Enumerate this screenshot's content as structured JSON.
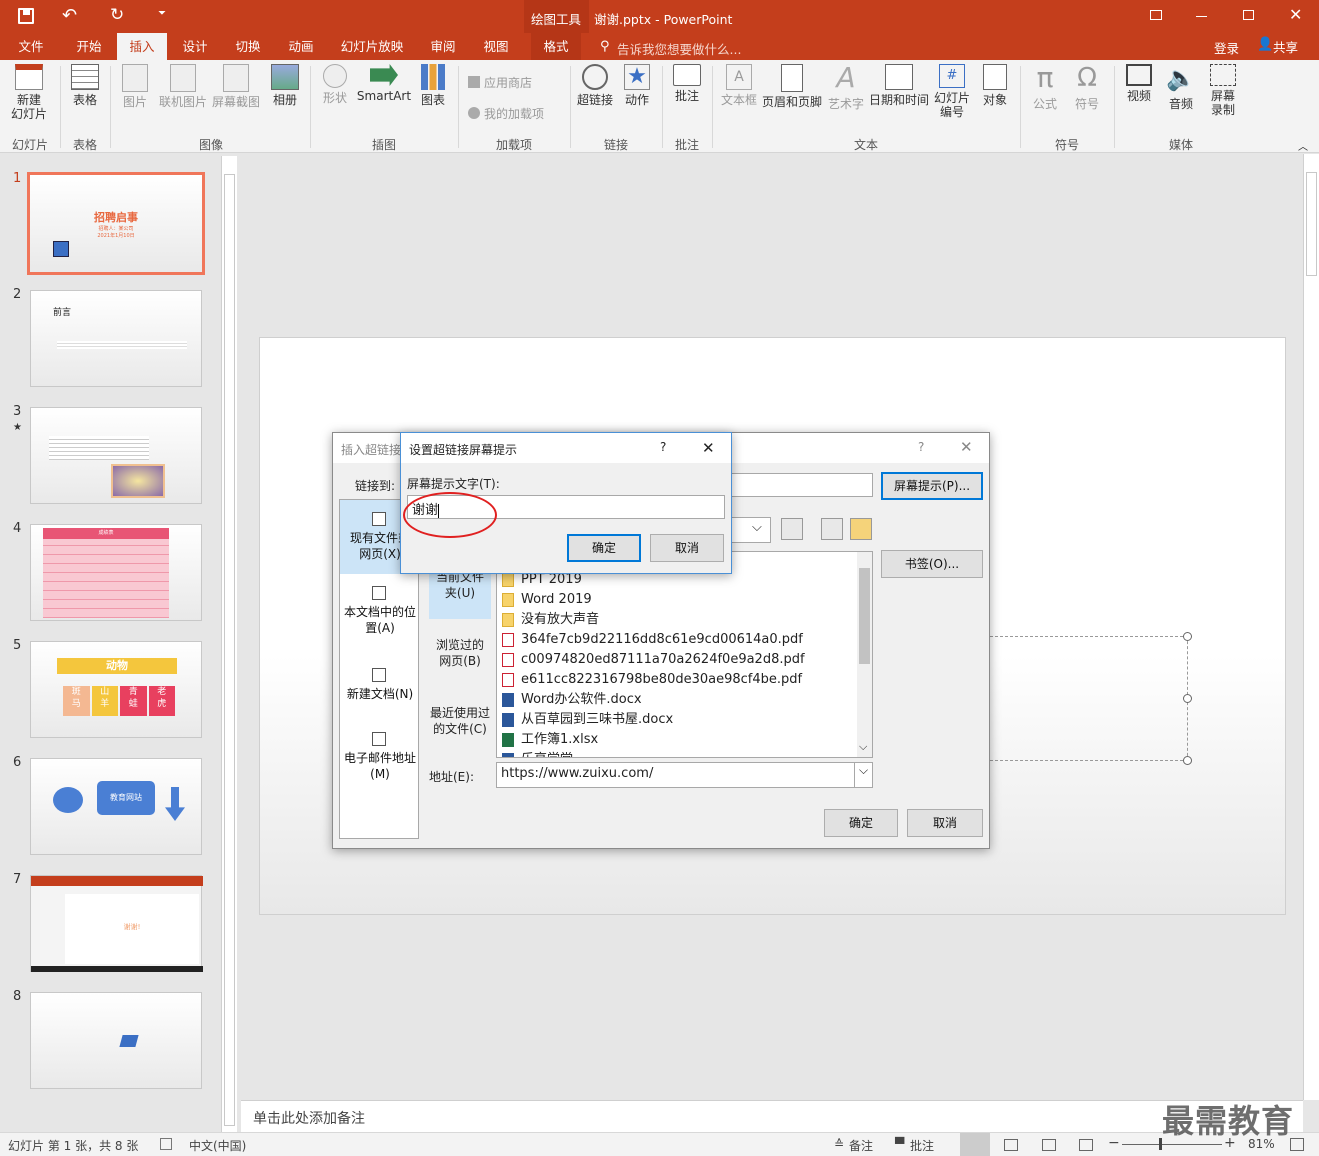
{
  "titlebar": {
    "context_tab": "绘图工具",
    "title": "谢谢.pptx - PowerPoint",
    "qat_undo": "↶",
    "qat_redo": "↻",
    "qat_more": "⏷"
  },
  "tabs": {
    "items": [
      "文件",
      "开始",
      "插入",
      "设计",
      "切换",
      "动画",
      "幻灯片放映",
      "审阅",
      "视图",
      "格式"
    ],
    "active": "插入",
    "tell_me": "告诉我您想要做什么...",
    "login": "登录",
    "share": "共享"
  },
  "ribbon": {
    "new_slide": "新建\n幻灯片",
    "table": "表格",
    "picture": "图片",
    "online_picture": "联机图片",
    "screenshot": "屏幕截图",
    "album": "相册",
    "shapes": "形状",
    "smartart": "SmartArt",
    "chart": "图表",
    "app_store": "应用商店",
    "my_addins": "我的加载项",
    "hyperlink": "超链接",
    "action": "动作",
    "comment": "批注",
    "textbox": "文本框",
    "header_footer": "页眉和页脚",
    "wordart": "艺术字",
    "datetime": "日期和时间",
    "slide_number": "幻灯片\n编号",
    "object": "对象",
    "equation": "公式",
    "symbol": "符号",
    "video": "视频",
    "audio": "音频",
    "screen_record": "屏幕\n录制",
    "groups": {
      "slides": "幻灯片",
      "tables": "表格",
      "images": "图像",
      "illustrations": "插图",
      "addins": "加载项",
      "links": "链接",
      "comments": "批注",
      "text": "文本",
      "symbols": "符号",
      "media": "媒体"
    }
  },
  "thumbnails": [
    {
      "num": "1",
      "title": "招聘启事",
      "sub1": "招聘人：某公司",
      "sub2": "2021年1月10日"
    },
    {
      "num": "2",
      "title": "前言"
    },
    {
      "num": "3",
      "star": "★"
    },
    {
      "num": "4",
      "table_title": "成绩表",
      "headers": [
        "序号",
        "姓名",
        "语文",
        "数学",
        "英语",
        "总分"
      ],
      "rows": [
        [
          "1",
          "王五",
          "98",
          "90",
          "81",
          "269"
        ],
        [
          "2",
          "周周",
          "95",
          "85",
          "88",
          "268"
        ],
        [
          "3",
          "李四",
          "96",
          "85",
          "88",
          "269"
        ],
        [
          "4",
          "张三",
          "89",
          "78",
          "85",
          "252"
        ],
        [
          "5",
          "大甲",
          "80",
          "90",
          "85",
          "255"
        ],
        [
          "6",
          "小明",
          "88",
          "76",
          "92",
          "249"
        ]
      ]
    },
    {
      "num": "5",
      "banner": "动物",
      "cells": [
        "斑\n马",
        "山\n羊",
        "青\n蛙",
        "老\n虎"
      ]
    },
    {
      "num": "6",
      "box": "教育网站"
    },
    {
      "num": "7",
      "text": "谢谢!"
    },
    {
      "num": "8"
    }
  ],
  "notes_placeholder": "单击此处添加备注",
  "status": {
    "slide_info": "幻灯片 第 1 张，共 8 张",
    "language": "中文(中国)",
    "notes": "备注",
    "comments": "批注",
    "zoom": "81%"
  },
  "hyperlink_dialog": {
    "title": "插入超链接",
    "help": "?",
    "link_to": "链接到:",
    "screen_tip_button": "屏幕提示(P)...",
    "bookmark_button": "书签(O)...",
    "link_options": [
      "现有文件或\n网页(X)",
      "本文档中的位\n置(A)",
      "新建文档(N)",
      "电子邮件地址\n(M)"
    ],
    "sub_options": [
      "当前文件\n夹(U)",
      "浏览过的\n网页(B)",
      "最近使用过\n的文件(C)"
    ],
    "files": [
      {
        "name": "PPT 2019",
        "type": "folder"
      },
      {
        "name": "Word 2019",
        "type": "folder"
      },
      {
        "name": "没有放大声音",
        "type": "folder"
      },
      {
        "name": "364fe7cb9d22116dd8c61e9cd00614a0.pdf",
        "type": "pdf"
      },
      {
        "name": "c00974820ed87111a70a2624f0e9a2d8.pdf",
        "type": "pdf"
      },
      {
        "name": "e611cc822316798be80de30ae98cf4be.pdf",
        "type": "pdf"
      },
      {
        "name": "Word办公软件.docx",
        "type": "word"
      },
      {
        "name": "从百草园到三味书屋.docx",
        "type": "word"
      },
      {
        "name": "工作簿1.xlsx",
        "type": "excel"
      },
      {
        "name": "乐享学堂",
        "type": "word"
      }
    ],
    "address_label": "地址(E):",
    "address_value": "https://www.zuixu.com/",
    "ok": "确定",
    "cancel": "取消"
  },
  "screentip_dialog": {
    "title": "设置超链接屏幕提示",
    "help": "?",
    "close": "✕",
    "label": "屏幕提示文字(T):",
    "value": "谢谢",
    "ok": "确定",
    "cancel": "取消"
  },
  "watermark": "最需教育",
  "colors": {
    "accent": "#c43e1c",
    "selection": "#f0765a",
    "focus_ring": "#e02020"
  }
}
